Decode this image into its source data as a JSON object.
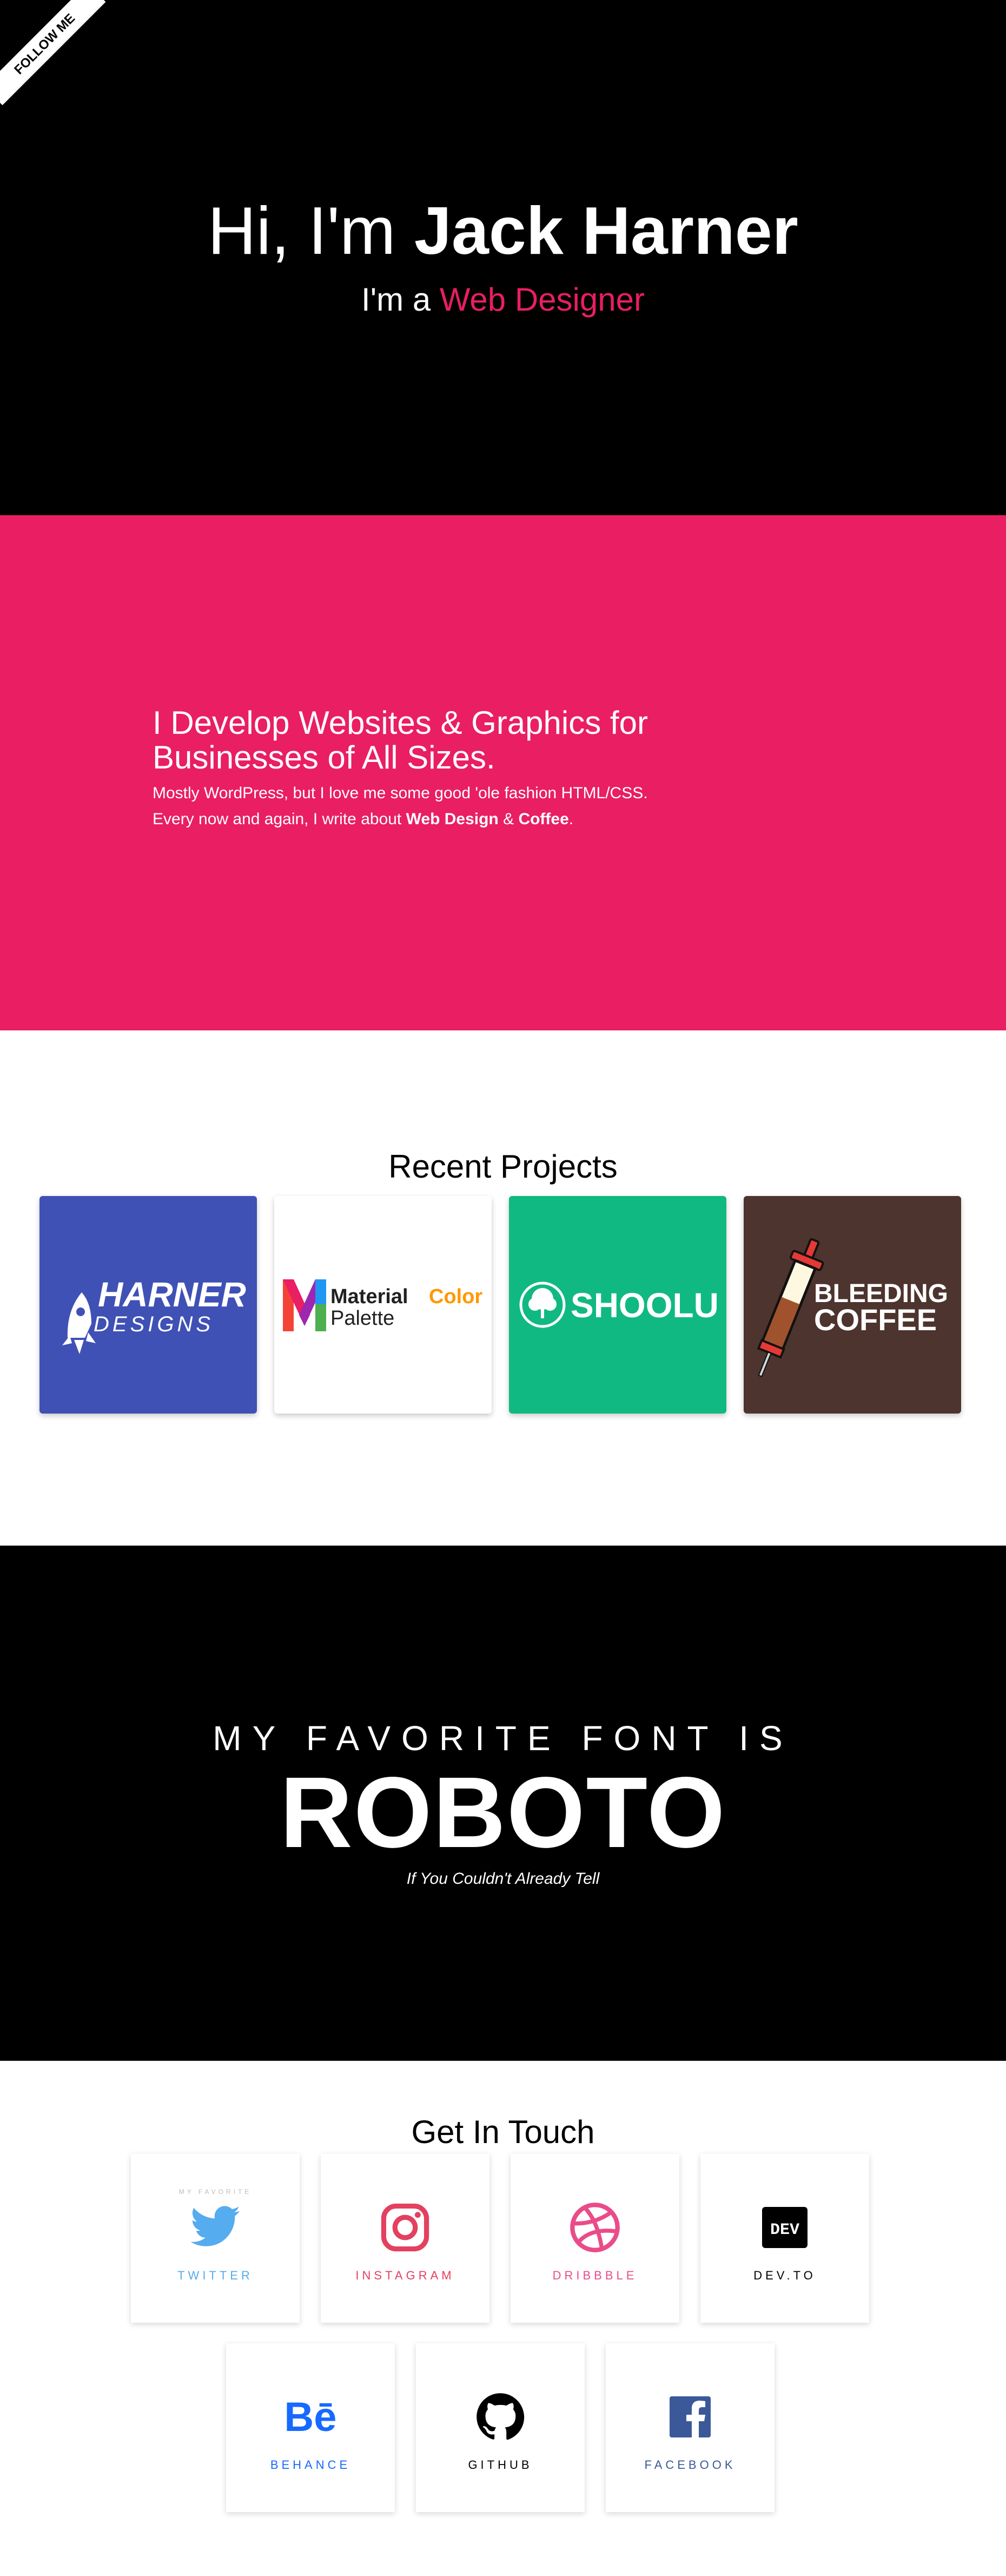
{
  "ribbon": {
    "label": "FOLLOW ME"
  },
  "hero": {
    "title_prefix": "Hi, I'm ",
    "title_name": "Jack Harner",
    "subtitle_prefix": "I'm a ",
    "subtitle_role": "Web Designer"
  },
  "about": {
    "heading": "I Develop Websites & Graphics for Businesses of All Sizes.",
    "line1": "Mostly WordPress, but I love me some good 'ole fashion HTML/CSS.",
    "line2_prefix": "Every now and again, I write about ",
    "line2_topic1": "Web Design",
    "line2_mid": " & ",
    "line2_topic2": "Coffee",
    "line2_suffix": "."
  },
  "projects": {
    "title": "Recent Projects",
    "items": [
      {
        "name": "Harner Designs",
        "logo_line1": "HARNER",
        "logo_line2": "DESIGNS",
        "bg": "#3f51b5"
      },
      {
        "name": "Material Color Palette",
        "logo_word1": "Material",
        "logo_word2": "Color",
        "logo_word3": "Palette",
        "bg": "#ffffff"
      },
      {
        "name": "Shoolu",
        "logo_text": "SHOOLU",
        "bg": "#10b981"
      },
      {
        "name": "Bleeding Coffee",
        "logo_line1": "BLEEDING",
        "logo_line2": "COFFEE",
        "bg": "#4e342e"
      }
    ]
  },
  "font": {
    "pretext": "MY FAVORITE FONT IS",
    "name": "ROBOTO",
    "note": "If You Couldn't Already Tell"
  },
  "contact": {
    "title": "Get In Touch",
    "items": [
      {
        "label": "TWITTER",
        "tiny": "MY FAVORITE",
        "icon": "twitter-icon",
        "color": "#55acee"
      },
      {
        "label": "INSTAGRAM",
        "icon": "instagram-icon",
        "color": "#e4405f"
      },
      {
        "label": "DRIBBBLE",
        "icon": "dribbble-icon",
        "color": "#ea4c89"
      },
      {
        "label": "DEV.TO",
        "icon_text": "DEV",
        "icon": "devto-icon",
        "color": "#000000"
      },
      {
        "label": "BEHANCE",
        "icon_text": "Bē",
        "icon": "behance-icon",
        "color": "#1769ff"
      },
      {
        "label": "GITHUB",
        "icon": "github-icon",
        "color": "#000000"
      },
      {
        "label": "FACEBOOK",
        "icon": "facebook-icon",
        "color": "#3b5998"
      }
    ]
  },
  "colors": {
    "accent": "#e91e63",
    "dark": "#000000",
    "light": "#ffffff"
  }
}
